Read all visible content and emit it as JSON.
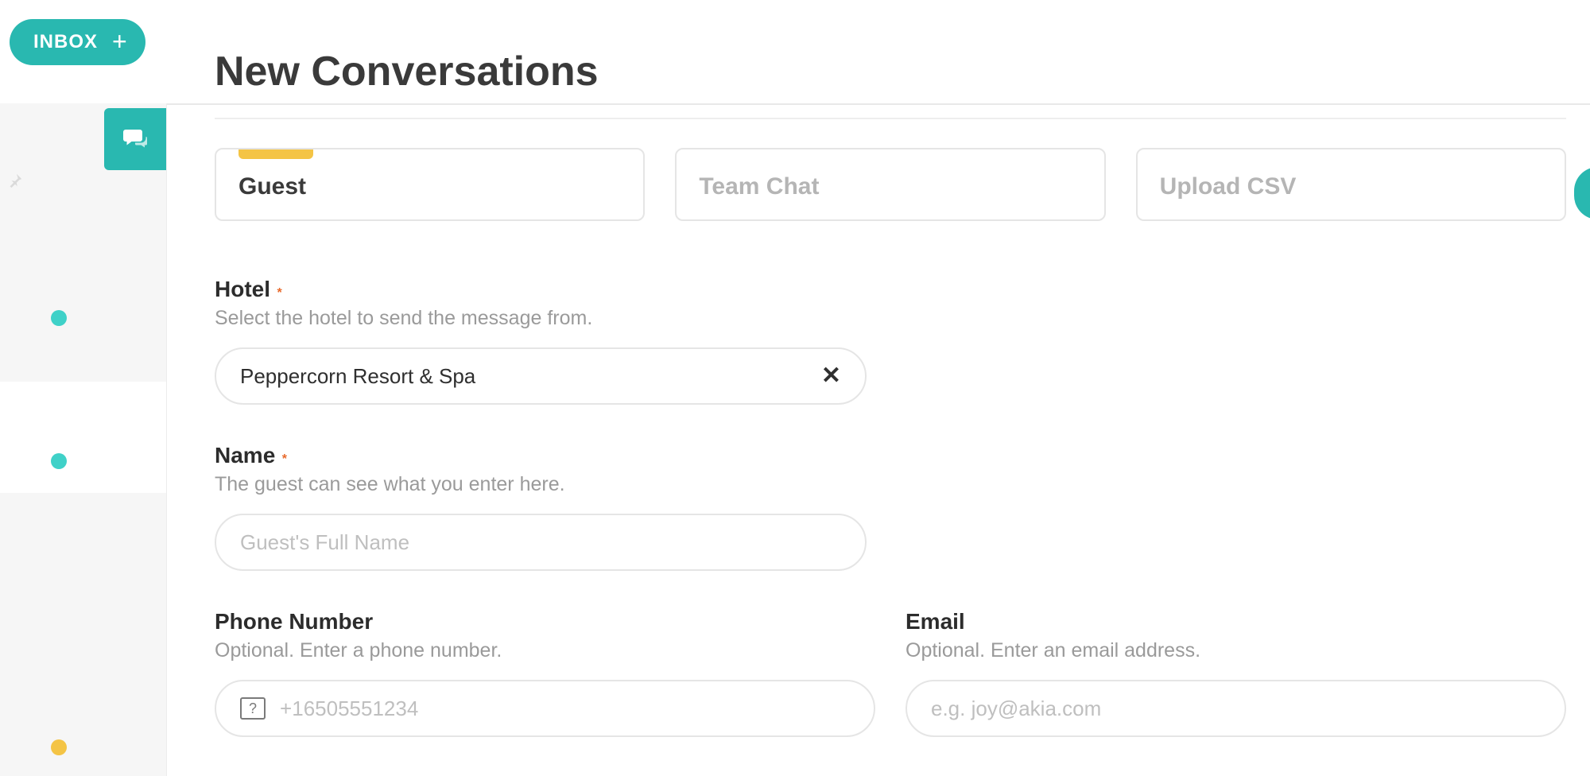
{
  "header": {
    "inbox_label": "INBOX",
    "plus_glyph": "+"
  },
  "page": {
    "title": "New Conversations"
  },
  "tabs": [
    {
      "label": "Guest",
      "active": true
    },
    {
      "label": "Team Chat",
      "active": false
    },
    {
      "label": "Upload CSV",
      "active": false
    }
  ],
  "form": {
    "hotel": {
      "label": "Hotel",
      "required_marker": "*",
      "help": "Select the hotel to send the message from.",
      "value": "Peppercorn Resort & Spa",
      "clear_glyph": "✕"
    },
    "name": {
      "label": "Name",
      "required_marker": "*",
      "help": "The guest can see what you enter here.",
      "placeholder": "Guest's Full Name"
    },
    "phone": {
      "label": "Phone Number",
      "help": "Optional. Enter a phone number.",
      "flag_glyph": "?",
      "placeholder": "+16505551234"
    },
    "email": {
      "label": "Email",
      "help": "Optional. Enter an email address.",
      "placeholder": "e.g. joy@akia.com"
    }
  },
  "colors": {
    "accent_teal": "#29b8b0",
    "accent_yellow": "#f4c445",
    "required_orange": "#e86a2c"
  }
}
